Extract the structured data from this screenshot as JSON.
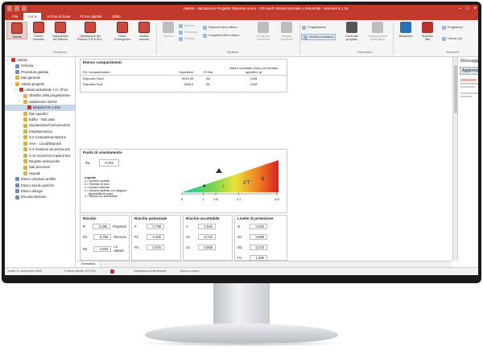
{
  "window": {
    "title": "Attività - Valutazione Progetto Deposito urano - CPI win® Attività  Normale e Industriali - Namirial 5.1.19"
  },
  "ribbon": {
    "tabs": [
      "File",
      "Home",
      "Archivi di base",
      "Firma digitale",
      "Utilità"
    ],
    "active_tab": "Home",
    "buttons": {
      "attivita": "Attività",
      "carico": "Carico\nIncendio",
      "valutazione_rischio": "Valutazione\ndel Rischio",
      "valutazione_frame": "Valutazione del\nRischio F.R.A.M.E.",
      "piano": "Piano\nEmergenza",
      "analisi": "Analisi\nscenari",
      "nuovo": "Nuovo",
      "elimina": "Elimina",
      "rinomina": "Rinomina",
      "duplica": "Duplica",
      "espandi": "Espandi intero albero",
      "comprimi": "Comprimi intero albero",
      "conferma": "Conferma\nmodifiche",
      "annulla": "Annulla\nmodifiche",
      "progettazione": "Progettazione",
      "verifica": "Verifica normativa",
      "controlla": "Controlla\nprogetto",
      "composizione": "Composizione\nautomatica",
      "relazione": "Relazione",
      "scambio": "Scambio\ndati",
      "programmi": "Programmi",
      "checklist": "Check-List"
    },
    "groups": [
      "Selezione",
      "Modifica",
      "Operazioni",
      "Strumenti"
    ]
  },
  "tree": {
    "items": [
      {
        "label": "Attività",
        "level": 0,
        "exp": "−",
        "color": "#c0392b"
      },
      {
        "label": "Schema",
        "level": 1,
        "exp": "",
        "color": "#6b8fb8"
      },
      {
        "label": "Procedura guidata",
        "level": 1,
        "exp": "",
        "color": "#6b8fb8"
      },
      {
        "label": "Dati generali",
        "level": 1,
        "exp": "›",
        "color": "#e0b03c"
      },
      {
        "label": "Attività progetto",
        "level": 1,
        "exp": "−",
        "color": "#e0b03c"
      },
      {
        "label": "Attività Industriale 7 t.l. (Princ",
        "level": 2,
        "exp": "−",
        "color": "#c0392b"
      },
      {
        "label": "Obiettivi della progettazione",
        "level": 3,
        "exp": "›",
        "color": "#e0b03c"
      },
      {
        "label": "Valutazione rischio",
        "level": 3,
        "exp": "−",
        "color": "#e0b03c"
      },
      {
        "label": "Metodo F.R.A.M.E.",
        "level": 4,
        "exp": "",
        "color": "#c0392b",
        "selected": true
      },
      {
        "label": "Dati specifici",
        "level": 3,
        "exp": "",
        "color": "#e0b03c"
      },
      {
        "label": "Edifici - Dati piani",
        "level": 3,
        "exp": "",
        "color": "#e0b03c"
      },
      {
        "label": "Separazione/Comunicazion",
        "level": 3,
        "exp": "",
        "color": "#e0b03c"
      },
      {
        "label": "Emplanimetrica",
        "level": 3,
        "exp": "",
        "color": "#e0b03c"
      },
      {
        "label": "S.2 Compartimentazione",
        "level": 3,
        "exp": "›",
        "color": "#e0b03c"
      },
      {
        "label": "Aree - Locali/Depositi",
        "level": 3,
        "exp": "›",
        "color": "#e0b03c"
      },
      {
        "label": "S.3 Gestione sicurezza anti",
        "level": 3,
        "exp": "›",
        "color": "#e0b03c"
      },
      {
        "label": "S.10 Sicurezza impianti tecr",
        "level": 3,
        "exp": "›",
        "color": "#e0b03c"
      },
      {
        "label": "Registro antincendio",
        "level": 3,
        "exp": "",
        "color": "#e0b03c"
      },
      {
        "label": "Dati accessori",
        "level": 3,
        "exp": "",
        "color": "#e0b03c"
      },
      {
        "label": "Segnali",
        "level": 3,
        "exp": "",
        "color": "#e0b03c"
      },
      {
        "label": "Elenco chiusure antifilo",
        "level": 1,
        "exp": "",
        "color": "#6b8fb8"
      },
      {
        "label": "Elenco tavole grafiche",
        "level": 1,
        "exp": "",
        "color": "#6b8fb8"
      },
      {
        "label": "Elenco disegni",
        "level": 1,
        "exp": "",
        "color": "#6b8fb8"
      },
      {
        "label": "Documentazione",
        "level": 1,
        "exp": "",
        "color": "#6b8fb8"
      }
    ]
  },
  "compartimenti": {
    "title": "Elenco compartimenti",
    "headers": [
      "Rif. compartimento",
      "Superficie",
      "R Vita",
      "Valore nominale carico di incendio specifico qf"
    ],
    "rows": [
      [
        "Deposito Nord",
        "2043,35",
        "B2",
        "1448"
      ],
      [
        "Deposito Sud",
        "1846,4",
        "B2",
        "1448"
      ]
    ]
  },
  "orientamento": {
    "title": "Punto di orientamento",
    "label": "Ra",
    "value": "0,792",
    "legend_title": "Legenda",
    "legend": [
      "a = Impianto sprinkler",
      "b = Rivelatori di fumo",
      "c = Impianto sprinkler",
      "d = Impianto sprinkler con maggiore ",
      "     disponibilità di acqua",
      "e = Rischio non ammissibile"
    ],
    "scale_ticks": [
      "0",
      "1",
      "1.6",
      "2.7",
      "4.5"
    ]
  },
  "rischio": {
    "title": "Rischio",
    "rows": [
      {
        "key": "R",
        "value": "3,196",
        "note": "Proprietà"
      },
      {
        "key": "R1",
        "value": "0,755",
        "note": "Persone"
      },
      {
        "key": "R2",
        "value": "2,832",
        "note": "Le attività"
      }
    ]
  },
  "rischio_potenziale": {
    "title": "Rischio potenziale",
    "rows": [
      {
        "key": "P",
        "value": "0,798"
      },
      {
        "key": "P1",
        "value": "0,492"
      },
      {
        "key": "P2",
        "value": "0,975"
      }
    ]
  },
  "rischio_accettabile": {
    "title": "Rischio accettabile",
    "rows": [
      {
        "key": "A",
        "value": "0,945"
      },
      {
        "key": "A1",
        "value": "0,734"
      },
      {
        "key": "A2",
        "value": "0,858"
      }
    ]
  },
  "protezione": {
    "title": "Livello di protezione",
    "rows": [
      {
        "key": "D",
        "value": "0,250"
      },
      {
        "key": "D1",
        "value": "0,888"
      },
      {
        "key": "D2",
        "value": "0,275"
      },
      {
        "key": "Fo",
        "value": "1,000"
      }
    ]
  },
  "bottom_tabs": [
    "Normativa",
    "Normativa di riferimento",
    "Elenco norme"
  ],
  "status": {
    "date": "lunedì 11 settembre 2023",
    "code": "Codice cliente: 817339"
  },
  "right_panel": {
    "title": "Messaggi",
    "button": "Aggiorna"
  }
}
